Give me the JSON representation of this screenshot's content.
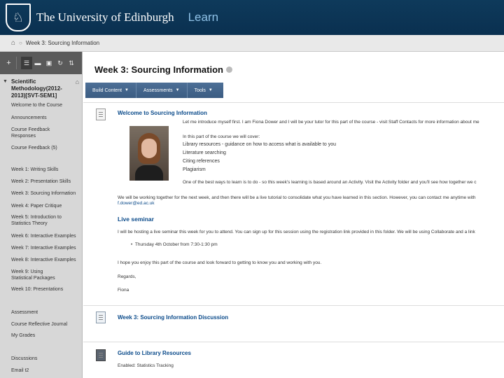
{
  "banner": {
    "university": "The University of Edinburgh",
    "app": "Learn"
  },
  "breadcrumb": {
    "current": "Week 3: Sourcing Information"
  },
  "sidebar": {
    "course_title": "Scientific Methodology(2012-2013)[SVT-SEM1]",
    "items": [
      "Welcome to the Course",
      "Announcements",
      "Course Feedback Responses",
      "Course Feedback (5)",
      "Week 1: Writing Skills",
      "Week 2: Presentation Skills",
      "Week 3: Sourcing Information",
      "Week 4: Paper Critique",
      "Week 5: Introduction to Statistics Theory",
      "Week 6: Interactive Examples",
      "Week 7: Interactive Examples",
      "Week 8: Interactive Examples",
      "Week 9: Using Statistical Packages",
      "Week 10: Presentations",
      "Assessment",
      "Course Reflective Journal",
      "My Grades",
      "Discussions",
      "Email t2"
    ]
  },
  "main": {
    "title": "Week 3: Sourcing Information",
    "actions": [
      {
        "label": "Build Content"
      },
      {
        "label": "Assessments"
      },
      {
        "label": "Tools"
      }
    ],
    "welcome": {
      "title": "Welcome to Sourcing Information",
      "intro": "Let me introduce myself first. I am Fiona Dower and I will be your tutor for this part of the course - visit Staff Contacts for more information about me",
      "lead": "In this part of the course we will cover:",
      "topics": [
        "Library resources - guidance on how to access what is available to you",
        "Literature searching",
        "Citing references",
        "Plagiarism"
      ],
      "activity": "One of the best ways to learn is to do - so this week's learning is based around an Activity. Visit the Activity folder and you'll see how together we c",
      "together": "We will be working together for the next week, and then there will be a live tutorial to consolidate what you have learned in this section. However, you can contact me anytime with",
      "together2": "f.dower@ed.ac.uk"
    },
    "live": {
      "title": "Live seminar",
      "text": "I will be hosting a live seminar this week for you to attend. You can sign up for this session using the registration link provided in this folder. We will be using Collaborate and a link",
      "bullet": "Thursday 4th October from 7:30-1:30 pm",
      "enjoy": "I hope you enjoy this part of the course and look forward to getting to know you and working with you.",
      "regards": "Regards,",
      "sign": "Fiona"
    },
    "discussion": {
      "title": "Week 3: Sourcing Information Discussion"
    },
    "library": {
      "title": "Guide to Library Resources",
      "sub": "Enabled: Statistics Tracking"
    }
  }
}
